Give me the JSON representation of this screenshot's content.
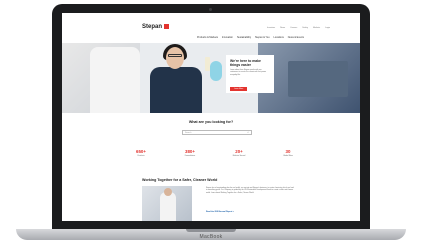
{
  "device": {
    "label": "MacBook"
  },
  "site": {
    "logo": "Stepan",
    "utility_nav": [
      "Investors",
      "News",
      "Careers",
      "Safety",
      "Markets",
      "Login"
    ],
    "main_nav": [
      "Products & Markets",
      "Innovation",
      "Sustainability",
      "Stepan & You",
      "Locations",
      "News & Events"
    ]
  },
  "hero": {
    "title": "We're here to make things easier",
    "text": "Learn about how Stepan works with our customers to create the chemicals that power everyday life.",
    "button": "Learn More"
  },
  "search": {
    "heading": "What are you looking for?",
    "placeholder": "Search"
  },
  "stats": [
    {
      "value": "650+",
      "label": "Products"
    },
    {
      "value": "380+",
      "label": "Formulations"
    },
    {
      "value": "20+",
      "label": "Markets Served"
    },
    {
      "value": "30",
      "label": "Global Sites"
    }
  ],
  "story": {
    "title": "Working Together for a Safer, Cleaner World",
    "text": "Stepan has a longstanding plan for our health, our society and Stepan's business, to create chemistry, which can lead to something great. Our Company is guided by the UN Sustainable Development Goals to create a safer and cleaner world. Learn about Working Together for a Safer, Cleaner World.",
    "link": "Read the 2020 Annual Report  >"
  },
  "colors": {
    "accent": "#e3342f",
    "link": "#1a5fa8"
  }
}
